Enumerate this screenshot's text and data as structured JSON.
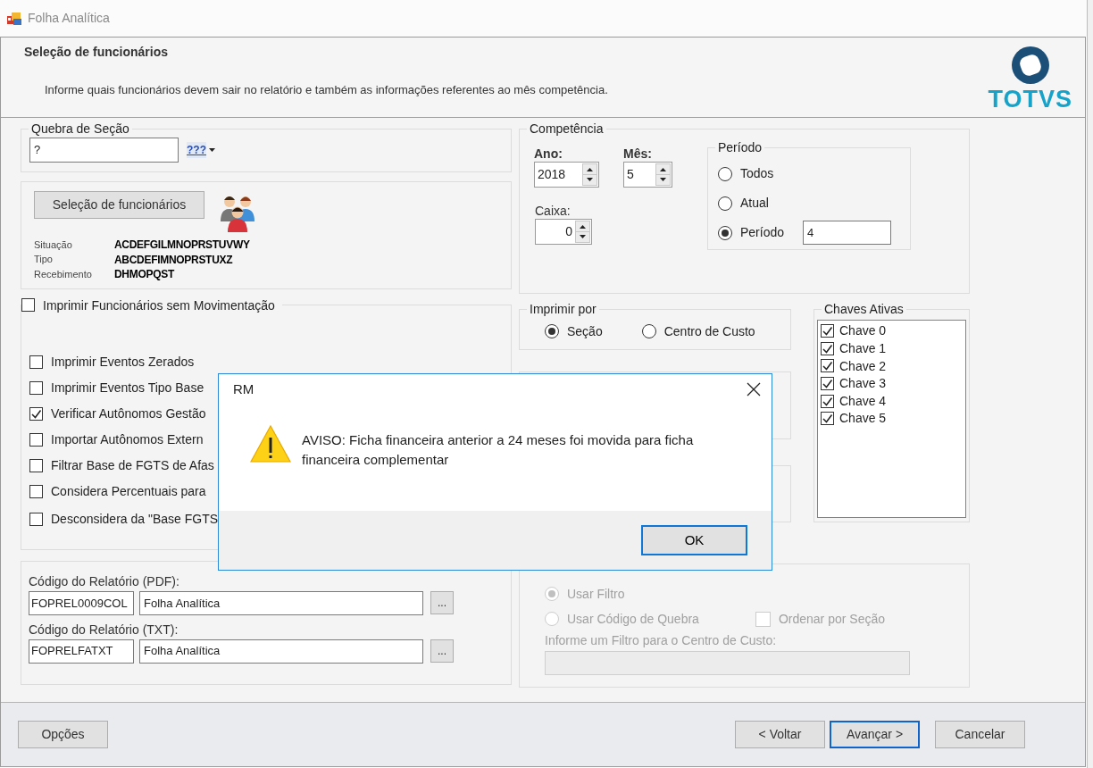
{
  "window": {
    "title": "Folha Analítica"
  },
  "header": {
    "title": "Seleção de funcionários",
    "description": "Informe quais funcionários devem sair no relatório e também as informações referentes ao mês competência.",
    "logo_text": "TOTVS"
  },
  "quebra_secao": {
    "legend": "Quebra de Seção",
    "value": "?",
    "button": "???"
  },
  "selecao": {
    "button": "Seleção de funcionários",
    "filters": [
      {
        "label": "Situação",
        "value": "ACDEFGILMNOPRSTUVWY"
      },
      {
        "label": "Tipo",
        "value": "ABCDEFIMNOPRSTUXZ"
      },
      {
        "label": "Recebimento",
        "value": "DHMOPQST"
      }
    ]
  },
  "options_group": {
    "label": "Imprimir Funcionários sem Movimentação",
    "checked": false,
    "options": [
      {
        "label": "Imprimir Eventos Zerados",
        "checked": false
      },
      {
        "label": "Imprimir Eventos Tipo Base",
        "checked": false
      },
      {
        "label": "Verificar Autônomos Gestão",
        "checked": true
      },
      {
        "label": "Importar Autônomos Extern",
        "checked": false
      },
      {
        "label": "Filtrar Base de FGTS de Afas",
        "checked": false
      },
      {
        "label": "Considera Percentuais para",
        "checked": false
      },
      {
        "label": "Desconsidera da \"Base FGTS",
        "checked": false
      }
    ]
  },
  "reports": [
    {
      "label": "Código do Relatório (PDF):",
      "code": "FOPREL0009COL",
      "name": "Folha Analítica",
      "button": "..."
    },
    {
      "label": "Código do Relatório (TXT):",
      "code": "FOPRELFATXT",
      "name": "Folha Analítica",
      "button": "..."
    }
  ],
  "competencia": {
    "legend": "Competência",
    "ano": {
      "label": "Ano:",
      "value": "2018"
    },
    "mes": {
      "label": "Mês:",
      "value": "5"
    },
    "caixa": {
      "label": "Caixa:",
      "value": "0"
    },
    "periodo": {
      "legend": "Período",
      "value": "4",
      "options": [
        {
          "label": "Todos",
          "selected": false
        },
        {
          "label": "Atual",
          "selected": false
        },
        {
          "label": "Período",
          "selected": true
        }
      ]
    }
  },
  "imprimir_por": {
    "legend": "Imprimir por",
    "options": [
      {
        "label": "Seção",
        "selected": true
      },
      {
        "label": "Centro de Custo",
        "selected": false
      }
    ]
  },
  "chaves": {
    "legend": "Chaves Ativas",
    "items": [
      {
        "label": "Chave 0",
        "checked": true
      },
      {
        "label": "Chave 1",
        "checked": true
      },
      {
        "label": "Chave 2",
        "checked": true
      },
      {
        "label": "Chave 3",
        "checked": true
      },
      {
        "label": "Chave 4",
        "checked": true
      },
      {
        "label": "Chave 5",
        "checked": true
      }
    ]
  },
  "filtro": {
    "disabled": true,
    "options": [
      {
        "label": "Usar Filtro",
        "selected": true
      },
      {
        "label": "Usar Código de Quebra",
        "selected": false
      }
    ],
    "ordenar": {
      "label": "Ordenar por Seção",
      "checked": false
    },
    "field_label": "Informe um Filtro para o Centro de Custo:"
  },
  "footer_buttons": [
    {
      "label": "Opções"
    }
  ],
  "nav_buttons": [
    {
      "label": "< Voltar",
      "focused": false
    },
    {
      "label": "Avançar >",
      "focused": true
    },
    {
      "label": "Cancelar",
      "focused": false
    }
  ],
  "dialog": {
    "title": "RM",
    "message": "AVISO: Ficha financeira anterior a 24 meses foi movida para ficha financeira complementar",
    "button": "OK"
  }
}
